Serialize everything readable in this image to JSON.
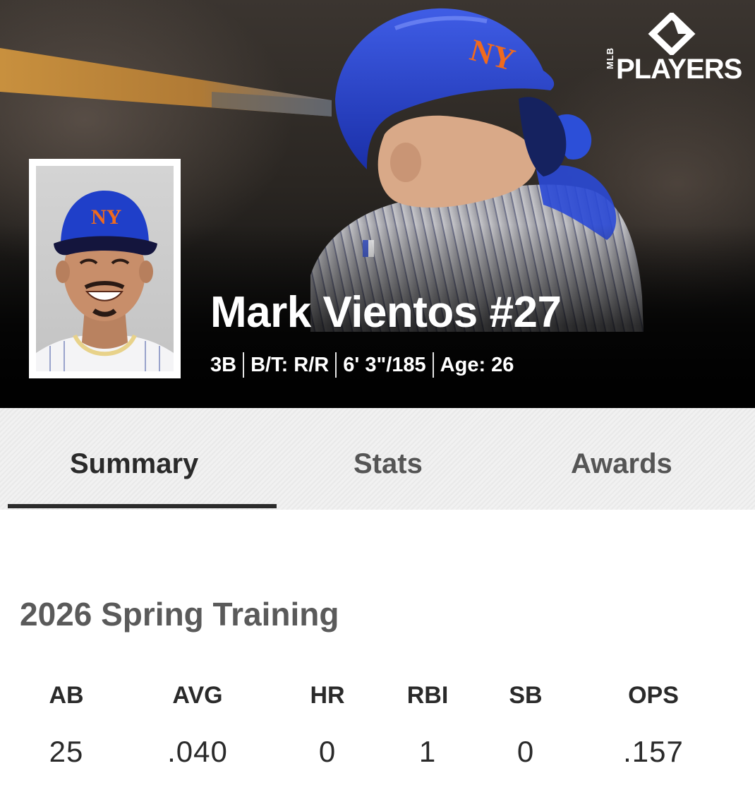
{
  "brand": {
    "mlb": "MLB",
    "players": "PLAYERS"
  },
  "player": {
    "name": "Mark Vientos #27",
    "position": "3B",
    "bats_throws": "B/T: R/R",
    "height_weight": "6' 3\"/185",
    "age": "Age: 26",
    "team_cap_logo": "NY"
  },
  "tabs": [
    {
      "label": "Summary",
      "active": true
    },
    {
      "label": "Stats",
      "active": false
    },
    {
      "label": "Awards",
      "active": false
    }
  ],
  "summary": {
    "section_title": "2026 Spring Training",
    "stats": [
      {
        "label": "AB",
        "value": "25"
      },
      {
        "label": "AVG",
        "value": ".040"
      },
      {
        "label": "HR",
        "value": "0"
      },
      {
        "label": "RBI",
        "value": "1"
      },
      {
        "label": "SB",
        "value": "0"
      },
      {
        "label": "OPS",
        "value": ".157"
      }
    ]
  },
  "colors": {
    "cap_blue": "#1f3fc9",
    "logo_orange": "#f06a1d",
    "underline": "#2b2b2b"
  }
}
